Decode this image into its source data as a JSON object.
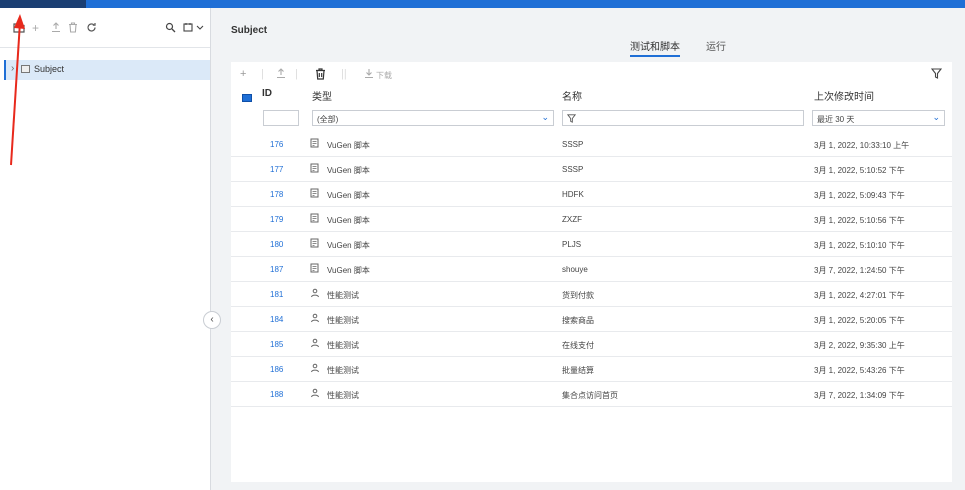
{
  "left_toolbar": {
    "icons": [
      "folder-icon",
      "plus-icon",
      "upload-icon",
      "trash-icon",
      "refresh-icon",
      "search-icon",
      "filter-dropdown-icon"
    ]
  },
  "tree": {
    "items": [
      {
        "label": "Subject"
      }
    ]
  },
  "main": {
    "title": "Subject",
    "tabs": [
      {
        "label": "测试和脚本",
        "active": true
      },
      {
        "label": "运行",
        "active": false
      }
    ]
  },
  "table_toolbar": {
    "download_label": "下载"
  },
  "table": {
    "headers": {
      "id": "ID",
      "type": "类型",
      "name": "名称",
      "modified": "上次修改时间"
    },
    "filters": {
      "type": "(全部)",
      "modified": "最近 30 天"
    },
    "rows": [
      {
        "id": "176",
        "type": "VuGen 脚本",
        "type_icon": "script-icon",
        "name": "SSSP",
        "modified": "3月 1, 2022, 10:33:10 上午"
      },
      {
        "id": "177",
        "type": "VuGen 脚本",
        "type_icon": "script-icon",
        "name": "SSSP",
        "modified": "3月 1, 2022, 5:10:52 下午"
      },
      {
        "id": "178",
        "type": "VuGen 脚本",
        "type_icon": "script-icon",
        "name": "HDFK",
        "modified": "3月 1, 2022, 5:09:43 下午"
      },
      {
        "id": "179",
        "type": "VuGen 脚本",
        "type_icon": "script-icon",
        "name": "ZXZF",
        "modified": "3月 1, 2022, 5:10:56 下午"
      },
      {
        "id": "180",
        "type": "VuGen 脚本",
        "type_icon": "script-icon",
        "name": "PLJS",
        "modified": "3月 1, 2022, 5:10:10 下午"
      },
      {
        "id": "187",
        "type": "VuGen 脚本",
        "type_icon": "script-icon",
        "name": "shouye",
        "modified": "3月 7, 2022, 1:24:50 下午"
      },
      {
        "id": "181",
        "type": "性能测试",
        "type_icon": "perf-test-icon",
        "name": "货到付款",
        "modified": "3月 1, 2022, 4:27:01 下午"
      },
      {
        "id": "184",
        "type": "性能测试",
        "type_icon": "perf-test-icon",
        "name": "搜索商品",
        "modified": "3月 1, 2022, 5:20:05 下午"
      },
      {
        "id": "185",
        "type": "性能测试",
        "type_icon": "perf-test-icon",
        "name": "在线支付",
        "modified": "3月 2, 2022, 9:35:30 上午"
      },
      {
        "id": "186",
        "type": "性能测试",
        "type_icon": "perf-test-icon",
        "name": "批量结算",
        "modified": "3月 1, 2022, 5:43:26 下午"
      },
      {
        "id": "188",
        "type": "性能测试",
        "type_icon": "perf-test-icon",
        "name": "集合点访问首页",
        "modified": "3月 7, 2022, 1:34:09 下午"
      }
    ]
  },
  "colors": {
    "accent": "#1f6fd6",
    "annotation": "#e8291c"
  }
}
